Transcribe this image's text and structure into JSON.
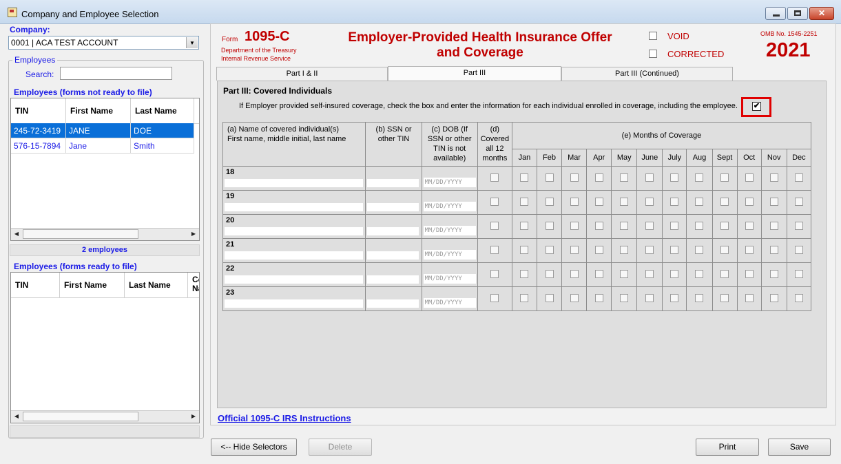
{
  "window": {
    "title": "Company and Employee Selection"
  },
  "company": {
    "label": "Company:",
    "selected": "0001 | ACA TEST ACCOUNT"
  },
  "employees_group": {
    "label": "Employees",
    "search_label": "Search:",
    "search_value": ""
  },
  "not_ready": {
    "title": "Employees (forms not ready to file)",
    "columns": [
      "TIN",
      "First Name",
      "Last Name"
    ],
    "rows": [
      {
        "tin": "245-72-3419",
        "first": "JANE",
        "last": "DOE",
        "selected": true
      },
      {
        "tin": "576-15-7894",
        "first": "Jane",
        "last": "Smith",
        "selected": false
      }
    ],
    "count": "2 employees"
  },
  "ready": {
    "title": "Employees (forms ready to file)",
    "columns": [
      "TIN",
      "First Name",
      "Last Name",
      "Co\nNa"
    ]
  },
  "form": {
    "form_word": "Form",
    "form_number": "1095-C",
    "dept_line1": "Department of the Treasury",
    "dept_line2": "Internal Revenue Service",
    "title_line1": "Employer-Provided Health Insurance Offer",
    "title_line2": "and Coverage",
    "void_label": "VOID",
    "corrected_label": "CORRECTED",
    "omb": "OMB No. 1545-2251",
    "year": "2021"
  },
  "tabs": [
    {
      "label": "Part I & II",
      "active": false
    },
    {
      "label": "Part III",
      "active": true
    },
    {
      "label": "Part III (Continued)",
      "active": false
    }
  ],
  "part3": {
    "title": "Part III:  Covered Individuals",
    "instruction": "If Employer provided self-insured coverage, check the box and enter the information for each individual enrolled in coverage, including the employee.",
    "self_insured_checked": true,
    "check_glyph": "✔",
    "col_a_line1": "(a) Name of covered individual(s)",
    "col_a_line2": "First name, middle initial, last name",
    "col_b_line1": "(b) SSN or",
    "col_b_line2": "other TIN",
    "col_c_line1": "(c) DOB (If",
    "col_c_line2": "SSN or other",
    "col_c_line3": "TIN is not",
    "col_c_line4": "available)",
    "col_d_line1": "(d)",
    "col_d_line2": "Covered",
    "col_d_line3": "all 12",
    "col_d_line4": "months",
    "col_e": "(e) Months of Coverage",
    "months": [
      "Jan",
      "Feb",
      "Mar",
      "Apr",
      "May",
      "June",
      "July",
      "Aug",
      "Sept",
      "Oct",
      "Nov",
      "Dec"
    ],
    "row_numbers": [
      "18",
      "19",
      "20",
      "21",
      "22",
      "23"
    ],
    "dob_placeholder": "MM/DD/YYYY"
  },
  "link": {
    "irs_instructions": "Official 1095-C IRS Instructions"
  },
  "buttons": {
    "hide_selectors": "<-- Hide Selectors",
    "delete": "Delete",
    "print": "Print",
    "save": "Save"
  },
  "colors": {
    "accent_red": "#c00000",
    "link_blue": "#1a1ae6",
    "selection_blue": "#0a6fd8"
  }
}
